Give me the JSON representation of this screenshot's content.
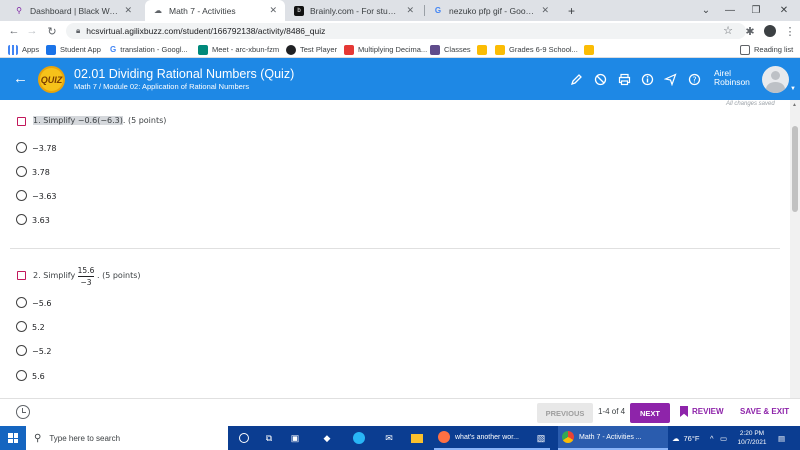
{
  "browser": {
    "tabs": [
      {
        "title": "Dashboard | Black Water Middle",
        "active": false
      },
      {
        "title": "Math 7 - Activities",
        "active": true
      },
      {
        "title": "Brainly.com - For students. By st",
        "active": false
      },
      {
        "title": "nezuko pfp gif - Google Search",
        "active": false
      }
    ],
    "new_tab": "+",
    "url": "hcsvirtual.agilixbuzz.com/student/166792138/activity/8486_quiz",
    "bookmarks": [
      "Apps",
      "Student App",
      "translation - Googl...",
      "Meet - arc-xbun-fzm",
      "Test Player",
      "Multiplying Decima...",
      "Classes",
      "Grades 6-9 School..."
    ],
    "reading_list": "Reading list"
  },
  "header": {
    "badge": "QUIZ",
    "title": "02.01 Dividing Rational Numbers (Quiz)",
    "subtitle": "Math 7 / Module 02: Application of Rational Numbers",
    "user_first": "Airel",
    "user_last": "Robinson",
    "save_status": "All changes saved"
  },
  "questions": [
    {
      "number": "1.",
      "prefix": "Simplify",
      "expression": "−0.6(−6.3)",
      "points": ". (5 points)",
      "options": [
        "−3.78",
        "3.78",
        "−3.63",
        "3.63"
      ]
    },
    {
      "number": "2.",
      "prefix": "Simplify",
      "numerator": "15.6",
      "denominator": "−3",
      "points": ". (5 points)",
      "options": [
        "−5.6",
        "5.2",
        "−5.2",
        "5.6"
      ]
    }
  ],
  "footer": {
    "previous": "PREVIOUS",
    "page_count": "1-4 of 4",
    "next": "NEXT",
    "review": "REVIEW",
    "save_exit": "SAVE & EXIT"
  },
  "taskbar": {
    "search_placeholder": "Type here to search",
    "apps": [
      {
        "label": "what's another wor..."
      },
      {
        "label": "Math 7 - Activities ..."
      }
    ],
    "temperature": "76°F",
    "time": "2:20 PM",
    "date": "10/7/2021"
  }
}
